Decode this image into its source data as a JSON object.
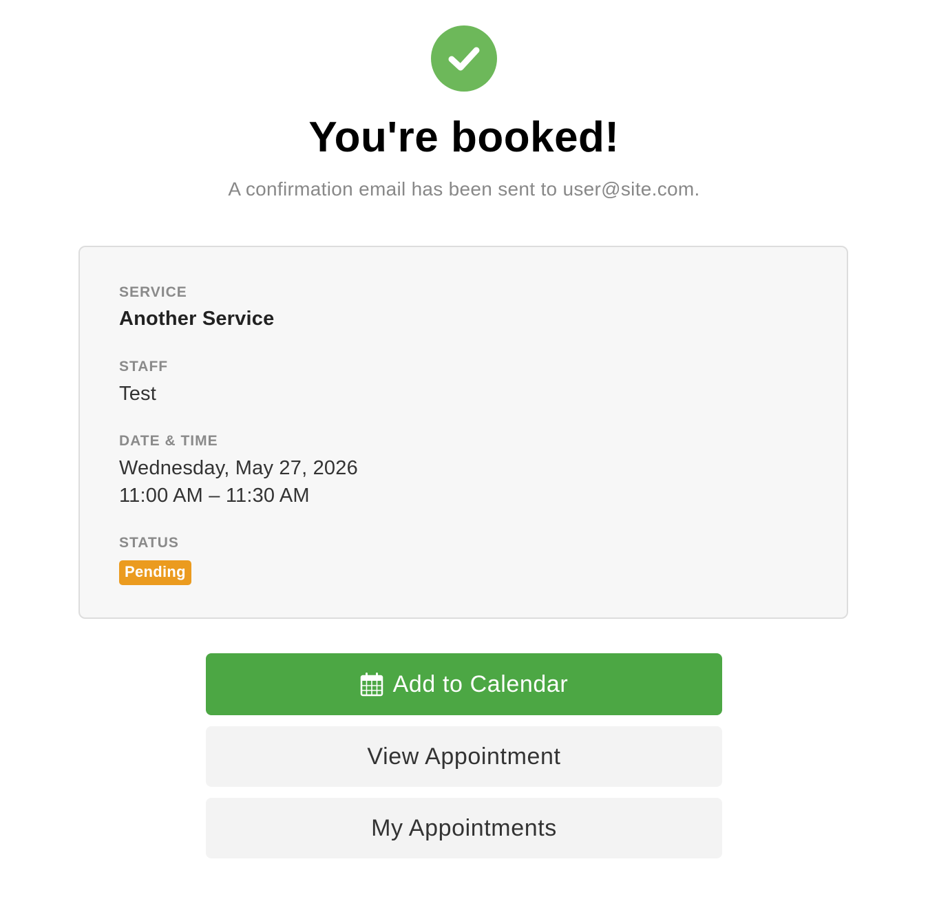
{
  "header": {
    "icon": "check-circle-icon",
    "title": "You're booked!",
    "subtitle": "A confirmation email has been sent to user@site.com."
  },
  "details": {
    "service_label": "SERVICE",
    "service_value": "Another Service",
    "staff_label": "STAFF",
    "staff_value": "Test",
    "datetime_label": "DATE & TIME",
    "date_value": "Wednesday, May 27, 2026",
    "time_value": "11:00 AM – 11:30 AM",
    "status_label": "STATUS",
    "status_value": "Pending"
  },
  "actions": {
    "add_calendar_label": "Add to Calendar",
    "add_calendar_icon": "calendar-icon",
    "view_appointment_label": "View Appointment",
    "my_appointments_label": "My Appointments"
  },
  "colors": {
    "success": "#6db85a",
    "primary_button": "#4ca744",
    "secondary_button": "#f3f3f3",
    "pending_badge": "#eb9b1f",
    "card_background": "#f7f7f7",
    "card_border": "#dddddd"
  }
}
